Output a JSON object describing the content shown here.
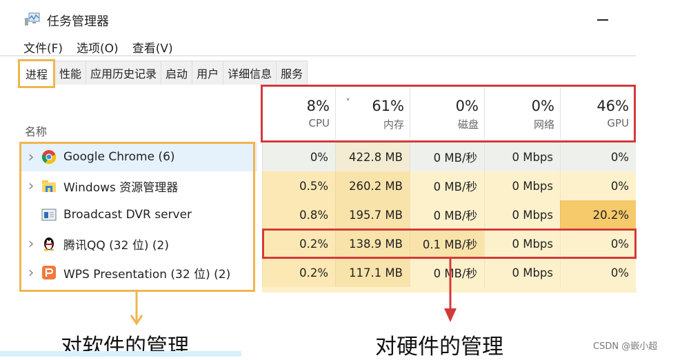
{
  "window": {
    "title": "任务管理器",
    "app_icon": "task-manager-icon"
  },
  "menu": [
    "文件(F)",
    "选项(O)",
    "查看(V)"
  ],
  "tabs": [
    {
      "label": "进程",
      "active": true
    },
    {
      "label": "性能"
    },
    {
      "label": "应用历史记录"
    },
    {
      "label": "启动"
    },
    {
      "label": "用户"
    },
    {
      "label": "详细信息"
    },
    {
      "label": "服务"
    }
  ],
  "columns": {
    "name": "名称",
    "cpu": {
      "pct": "8%",
      "label": "CPU"
    },
    "memory": {
      "pct": "61%",
      "label": "内存",
      "sort": "˅"
    },
    "disk": {
      "pct": "0%",
      "label": "磁盘"
    },
    "network": {
      "pct": "0%",
      "label": "网络"
    },
    "gpu": {
      "pct": "46%",
      "label": "GPU"
    }
  },
  "processes": [
    {
      "name": "Google Chrome (6)",
      "icon": "chrome-icon",
      "expandable": true,
      "selected": true,
      "cpu": "0%",
      "memory": "422.8 MB",
      "disk": "0 MB/秒",
      "network": "0 Mbps",
      "gpu": "0%"
    },
    {
      "name": "Windows 资源管理器",
      "icon": "explorer-icon",
      "expandable": true,
      "cpu": "0.5%",
      "memory": "260.2 MB",
      "disk": "0 MB/秒",
      "network": "0 Mbps",
      "gpu": "0%"
    },
    {
      "name": "Broadcast DVR server",
      "icon": "dvr-server-icon",
      "expandable": false,
      "cpu": "0.8%",
      "memory": "195.7 MB",
      "disk": "0 MB/秒",
      "network": "0 Mbps",
      "gpu": "20.2%"
    },
    {
      "name": "腾讯QQ (32 位) (2)",
      "icon": "qq-penguin-icon",
      "expandable": true,
      "cpu": "0.2%",
      "memory": "138.9 MB",
      "disk": "0.1 MB/秒",
      "network": "0 Mbps",
      "gpu": "0%"
    },
    {
      "name": "WPS Presentation (32 位) (2)",
      "icon": "wps-presentation-icon",
      "expandable": true,
      "cpu": "0.2%",
      "memory": "117.1 MB",
      "disk": "0 MB/秒",
      "network": "0 Mbps",
      "gpu": "0%"
    }
  ],
  "annotations": {
    "software": "对软件的管理",
    "hardware": "对硬件的管理",
    "software_color": "#f0b54d",
    "hardware_color": "#d23a3a"
  },
  "watermark": "CSDN @嵌小超"
}
